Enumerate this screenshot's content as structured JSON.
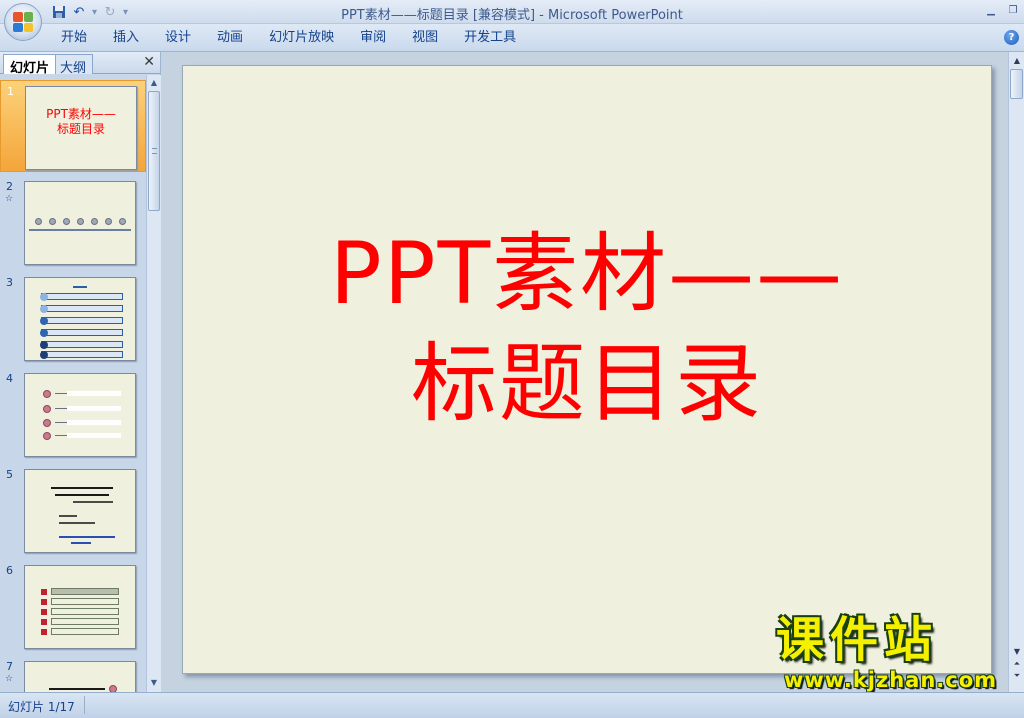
{
  "window": {
    "title": "PPT素材——标题目录 [兼容模式] - Microsoft PowerPoint",
    "minimize": "▁",
    "restore": "❐"
  },
  "ribbon": {
    "tabs": [
      "开始",
      "插入",
      "设计",
      "动画",
      "幻灯片放映",
      "审阅",
      "视图",
      "开发工具"
    ],
    "help": "?"
  },
  "panel": {
    "tab_slides": "幻灯片",
    "tab_outline": "大纲",
    "close": "✕",
    "slides": [
      {
        "num": "1",
        "title_line1": "PPT素材——",
        "title_line2": "标题目录"
      },
      {
        "num": "2",
        "star": "☆"
      },
      {
        "num": "3"
      },
      {
        "num": "4"
      },
      {
        "num": "5"
      },
      {
        "num": "6"
      },
      {
        "num": "7",
        "star": "☆"
      }
    ]
  },
  "slide": {
    "title_line1": "PPT素材——",
    "title_line2": "标题目录",
    "color": "#ff0000"
  },
  "watermark": {
    "big": "课件站",
    "url": "www.kjzhan.com"
  },
  "status": {
    "slide_info": "幻灯片 1/17"
  },
  "colors": {
    "accent": "#15428b",
    "slide_bg": "#eff0dd",
    "selected": "#f4a53a"
  }
}
